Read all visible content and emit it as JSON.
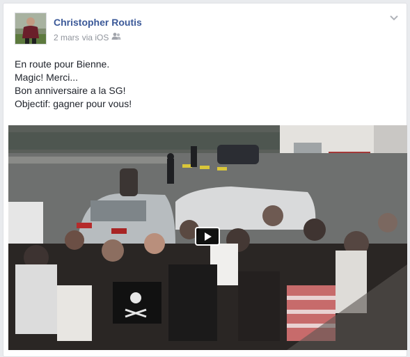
{
  "post": {
    "author": "Christopher Routis",
    "date": "2 mars",
    "via": "via iOS",
    "audience_icon": "friends-icon",
    "menu_icon": "chevron-down-icon",
    "lines": [
      "En route pour Bienne.",
      "Magic! Merci...",
      "Bon anniversaire a la SG!",
      "Objectif: gagner pour vous!"
    ]
  },
  "video": {
    "play_icon": "play-icon"
  },
  "colors": {
    "author_link": "#3b5998",
    "meta_text": "#90949c",
    "body_text": "#1d2129",
    "card_border": "#dfe0e4"
  }
}
